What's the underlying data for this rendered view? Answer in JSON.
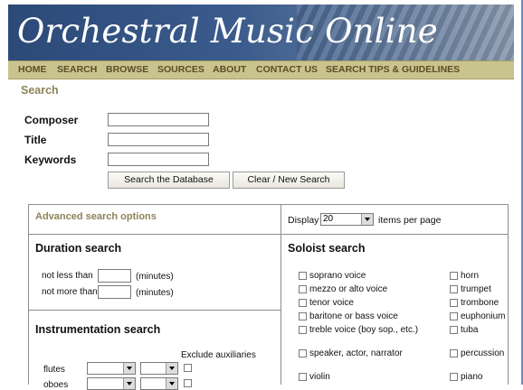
{
  "header": {
    "site_title": "Orchestral Music Online"
  },
  "nav": [
    "HOME",
    "SEARCH",
    "BROWSE",
    "SOURCES",
    "ABOUT",
    "CONTACT US",
    "SEARCH TIPS & GUIDELINES"
  ],
  "page": {
    "heading": "Search"
  },
  "search_form": {
    "composer_label": "Composer",
    "title_label": "Title",
    "keywords_label": "Keywords",
    "composer_value": "",
    "title_value": "",
    "keywords_value": "",
    "search_button": "Search the Database",
    "clear_button": "Clear / New Search"
  },
  "advanced": {
    "title": "Advanced search options",
    "display_label": "Display",
    "display_value": "20",
    "display_suffix": "items per page"
  },
  "duration": {
    "title": "Duration search",
    "not_less_label": "not less than",
    "not_more_label": "not more than",
    "unit": "(minutes)"
  },
  "instrumentation": {
    "title": "Instrumentation search",
    "exclude_label": "Exclude auxiliaries",
    "rows": [
      "flutes",
      "oboes"
    ]
  },
  "soloist": {
    "title": "Soloist search",
    "left": [
      "soprano voice",
      "mezzo or alto voice",
      "tenor voice",
      "baritone or bass voice",
      "treble voice (boy sop., etc.)",
      "speaker, actor, narrator",
      "violin"
    ],
    "right": [
      "horn",
      "trumpet",
      "trombone",
      "euphonium",
      "tuba",
      "percussion",
      "piano"
    ]
  }
}
